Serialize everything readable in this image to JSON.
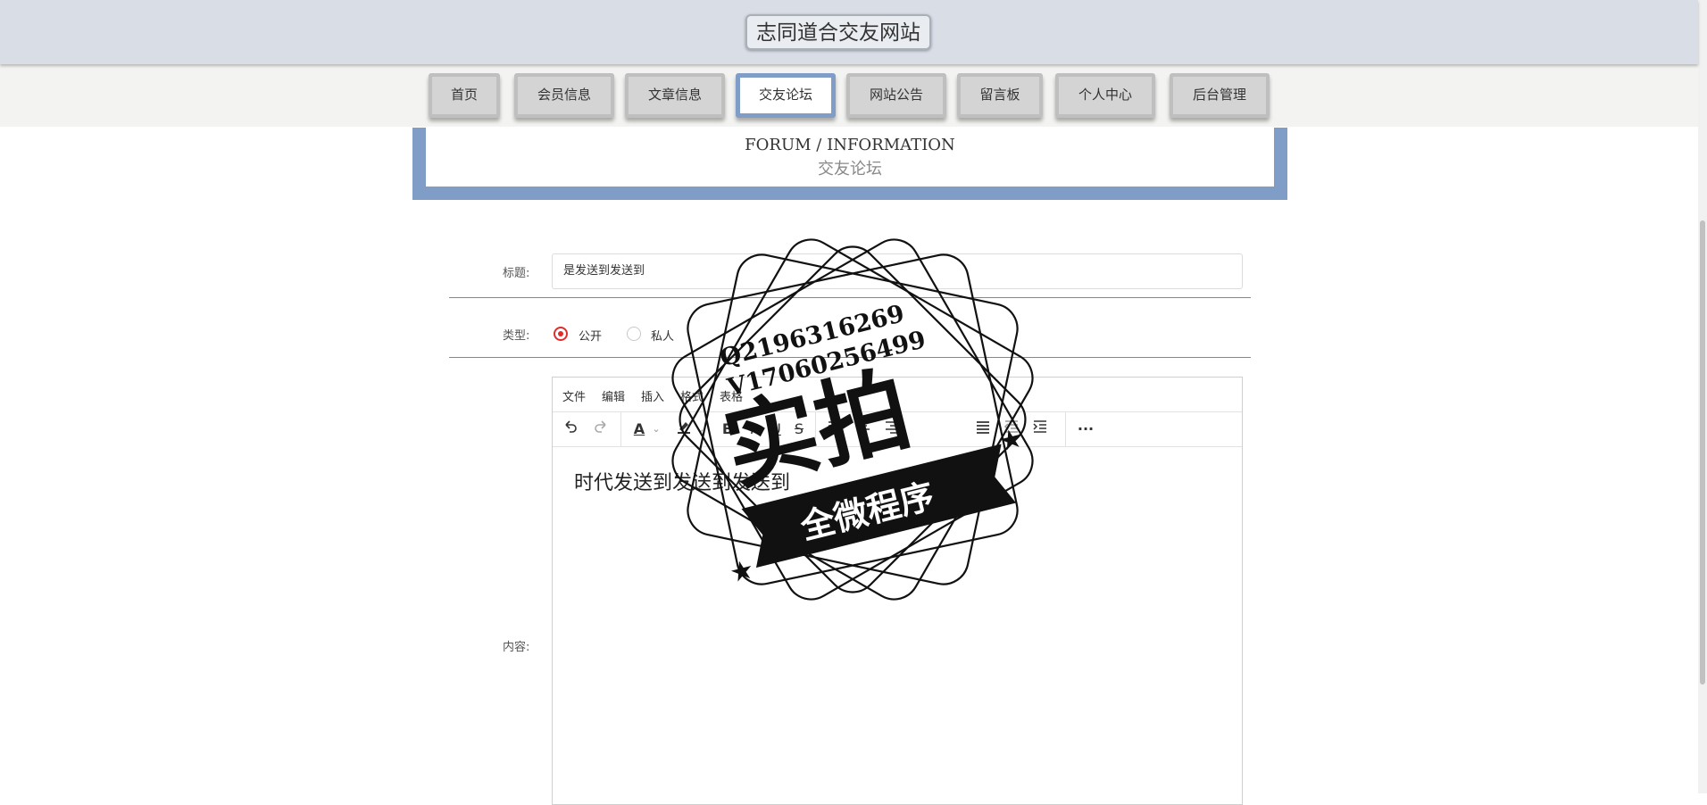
{
  "site": {
    "title": "志同道合交友网站"
  },
  "nav": [
    {
      "label": "首页",
      "active": false
    },
    {
      "label": "会员信息",
      "active": false
    },
    {
      "label": "文章信息",
      "active": false
    },
    {
      "label": "交友论坛",
      "active": true
    },
    {
      "label": "网站公告",
      "active": false
    },
    {
      "label": "留言板",
      "active": false
    },
    {
      "label": "个人中心",
      "active": false
    },
    {
      "label": "后台管理",
      "active": false
    }
  ],
  "banner": {
    "en": "FORUM / INFORMATION",
    "cn": "交友论坛"
  },
  "form": {
    "title_label": "标题:",
    "title_value": "是发送到发送到",
    "type_label": "类型:",
    "type_options": [
      {
        "label": "公开",
        "checked": true
      },
      {
        "label": "私人",
        "checked": false
      }
    ],
    "content_label": "内容:"
  },
  "editor": {
    "menus": [
      "文件",
      "编辑",
      "插入",
      "格式",
      "表格"
    ],
    "toolbar": {
      "undo": "undo-icon",
      "redo": "redo-icon",
      "font_color": "A",
      "bold": "B",
      "italic": "I",
      "underline": "U",
      "strike": "S",
      "more": "···"
    },
    "content": "时代发送到发送到发送到"
  },
  "watermark": {
    "line1": "Q2196316269",
    "line2": "V17060256499",
    "main": "实拍",
    "ribbon": "全微程序"
  },
  "colors": {
    "accent": "#7f9dc6",
    "header_bg": "#d8dde6",
    "radio_checked": "#e02b2b"
  }
}
